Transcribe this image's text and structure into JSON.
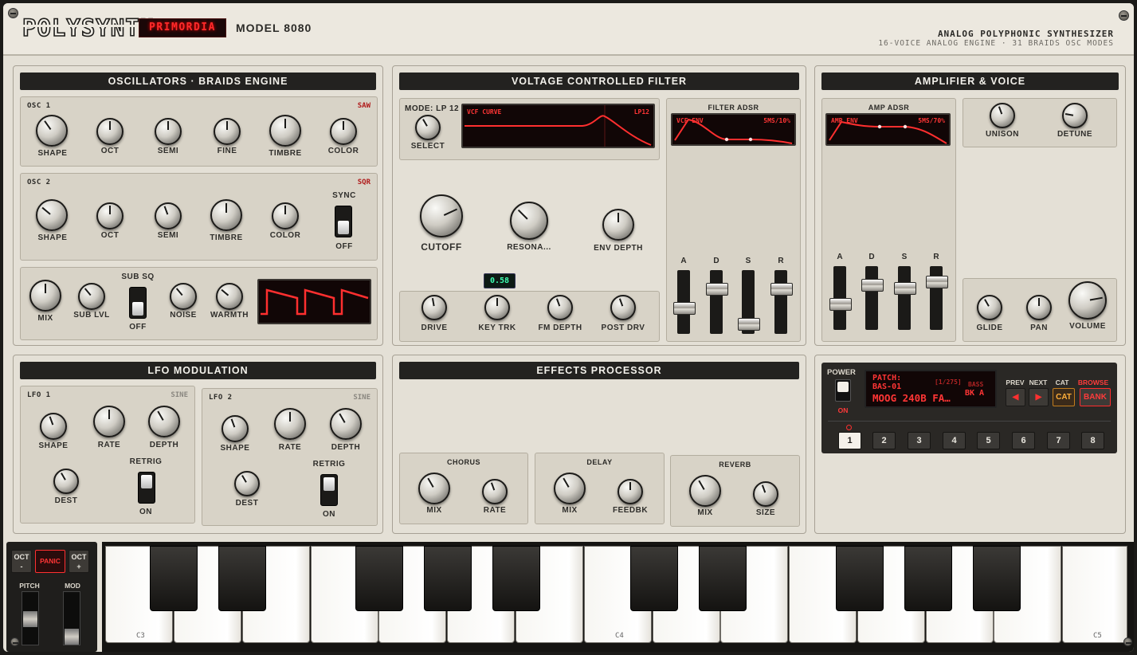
{
  "header": {
    "logo": "POLYSYNTH",
    "brand": "PRIMORDIA",
    "model": "MODEL 8080",
    "tagline": "ANALOG POLYPHONIC SYNTHESIZER",
    "subtagline": "16-VOICE ANALOG ENGINE · 31 BRAIDS OSC MODES"
  },
  "osc": {
    "title": "OSCILLATORS · BRAIDS ENGINE",
    "osc1": {
      "label": "OSC 1",
      "wave": "SAW",
      "knobs": [
        "SHAPE",
        "OCT",
        "SEMI",
        "FINE",
        "TIMBRE",
        "COLOR"
      ]
    },
    "osc2": {
      "label": "OSC 2",
      "wave": "SQR",
      "knobs": [
        "SHAPE",
        "OCT",
        "SEMI",
        "TIMBRE",
        "COLOR"
      ],
      "sync_label": "SYNC",
      "sync_state": "OFF"
    },
    "mix": {
      "knobs": [
        "MIX",
        "SUB LVL",
        "NOISE",
        "WARMTH"
      ],
      "subsq_label": "SUB SQ",
      "subsq_state": "OFF"
    }
  },
  "filter": {
    "title": "VOLTAGE CONTROLLED FILTER",
    "mode": "MODE: LP 12",
    "select": "SELECT",
    "curve_label": "VCF CURVE",
    "curve_mode": "LP12",
    "cutoff": "CUTOFF",
    "resonance": "RESONA...",
    "env_depth": "ENV DEPTH",
    "readout": "0.58",
    "small": [
      "DRIVE",
      "KEY TRK",
      "FM DEPTH",
      "POST DRV"
    ],
    "adsr_title": "FILTER ADSR",
    "adsr_screen": "VCF ENV",
    "adsr_value": "5MS/10%",
    "adsr_labels": [
      "A",
      "D",
      "S",
      "R"
    ]
  },
  "amp": {
    "title": "AMPLIFIER & VOICE",
    "adsr_title": "AMP ADSR",
    "adsr_screen": "AMP ENV",
    "adsr_value": "5MS/70%",
    "adsr_labels": [
      "A",
      "D",
      "S",
      "R"
    ],
    "unison": "UNISON",
    "detune": "DETUNE",
    "glide": "GLIDE",
    "pan": "PAN",
    "volume": "VOLUME"
  },
  "lfo": {
    "title": "LFO MODULATION",
    "lfo1": {
      "label": "LFO 1",
      "wave": "SINE",
      "shape": "SHAPE",
      "rate": "RATE",
      "depth": "DEPTH",
      "dest": "DEST",
      "retrig": "RETRIG",
      "retrig_state": "ON"
    },
    "lfo2": {
      "label": "LFO 2",
      "wave": "SINE",
      "shape": "SHAPE",
      "rate": "RATE",
      "depth": "DEPTH",
      "dest": "DEST",
      "retrig": "RETRIG",
      "retrig_state": "ON"
    }
  },
  "fx": {
    "title": "EFFECTS PROCESSOR",
    "chorus": {
      "label": "CHORUS",
      "k1": "MIX",
      "k2": "RATE"
    },
    "delay": {
      "label": "DELAY",
      "k1": "MIX",
      "k2": "FEEDBK"
    },
    "reverb": {
      "label": "REVERB",
      "k1": "MIX",
      "k2": "SIZE"
    }
  },
  "patch": {
    "power": "POWER",
    "power_state": "ON",
    "line1": "PATCH:",
    "line2": "BAS-01",
    "name": "MOOG 240B FA…",
    "counter": "[1/275]",
    "category": "BASS",
    "bank": "BK A",
    "prev": "PREV",
    "next": "NEXT",
    "cat": "CAT",
    "browse": "BROWSE",
    "cat_btn": "CAT",
    "bank_btn": "BANK",
    "slots": [
      "1",
      "2",
      "3",
      "4",
      "5",
      "6",
      "7",
      "8"
    ]
  },
  "keyboard": {
    "oct_down": "OCT\n-",
    "panic": "PANIC",
    "oct_up": "OCT\n+",
    "pitch": "PITCH",
    "mod": "MOD",
    "labels": [
      "C3",
      "C4",
      "C5"
    ]
  },
  "colors": {
    "accent": "#ff2a2a",
    "lcd_green": "#3dffb2",
    "panel": "#e4e0d6"
  }
}
